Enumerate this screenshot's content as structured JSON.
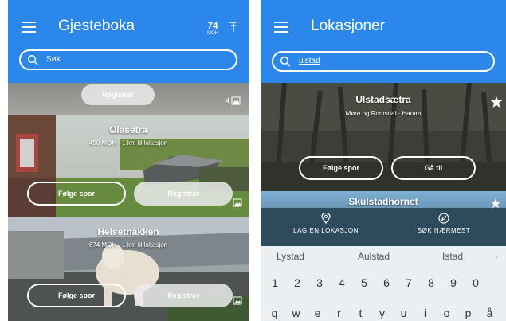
{
  "left": {
    "title": "Gjesteboka",
    "moh_value": "74",
    "moh_unit": "MOH",
    "search_placeholder": "Søk",
    "top_card": {
      "register": "Registrer",
      "image_count": "4"
    },
    "cards": [
      {
        "name": "Olasetra",
        "info": "450 MOH · 1 km til lokasjon",
        "follow": "Følge spor",
        "register": "Registrer"
      },
      {
        "name": "Helsetnakken",
        "info": "674 MOH · 1 km til lokasjon",
        "follow": "Følge spor",
        "register": "Registrer"
      }
    ]
  },
  "right": {
    "title": "Lokasjoner",
    "search_value": "ulstad",
    "cards": [
      {
        "name": "Ulstadsætra",
        "info": "Møre og Romsdal · Haram",
        "follow": "Følge spor",
        "goto": "Gå til"
      },
      {
        "name": "Skulstadhornet"
      }
    ],
    "nav": {
      "add": "LAG EN LOKASJON",
      "search": "SØK NÆRMEST"
    },
    "suggestions": [
      "Lystad",
      "Aulstad",
      "Istad"
    ],
    "numbers": [
      "1",
      "2",
      "3",
      "4",
      "5",
      "6",
      "7",
      "8",
      "9",
      "0"
    ],
    "letters": [
      "q",
      "w",
      "e",
      "r",
      "t",
      "y",
      "u",
      "i",
      "o",
      "p",
      "å"
    ]
  },
  "colors": {
    "primary": "#2b88ea",
    "nav": "#2e4b5e"
  }
}
